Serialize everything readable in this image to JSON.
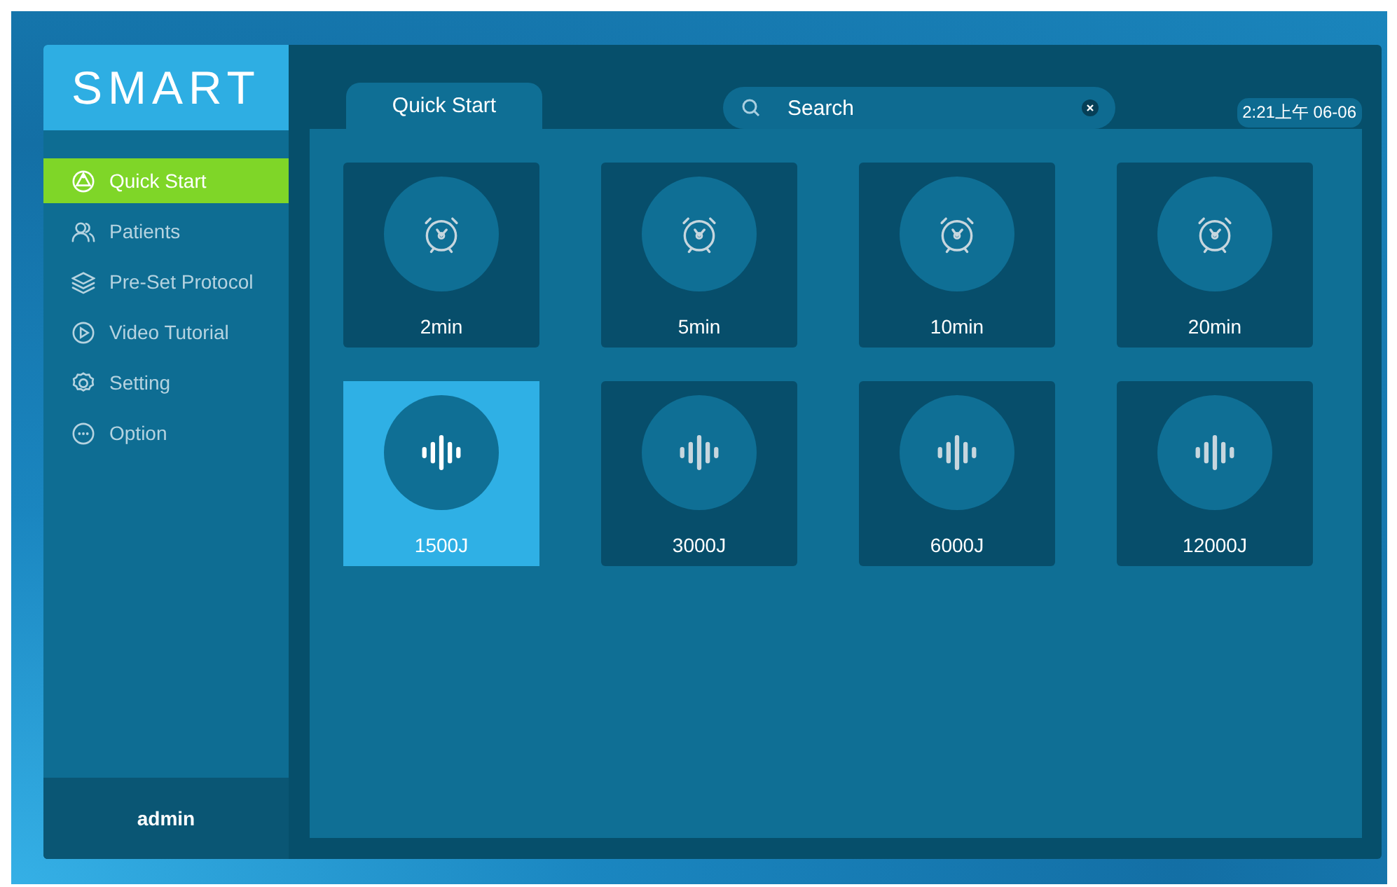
{
  "logo": "SMART",
  "sidebar": {
    "items": [
      {
        "label": "Quick Start",
        "selected": true
      },
      {
        "label": "Patients",
        "selected": false
      },
      {
        "label": "Pre-Set Protocol",
        "selected": false
      },
      {
        "label": "Video Tutorial",
        "selected": false
      },
      {
        "label": "Setting",
        "selected": false
      },
      {
        "label": "Option",
        "selected": false
      }
    ],
    "user": "admin"
  },
  "tabs": [
    {
      "label": "Quick Start",
      "selected": true
    }
  ],
  "search": {
    "placeholder": "Search"
  },
  "clock": "2:21上午 06-06",
  "tiles": [
    {
      "label": "2min",
      "kind": "timer",
      "selected": false
    },
    {
      "label": "5min",
      "kind": "timer",
      "selected": false
    },
    {
      "label": "10min",
      "kind": "timer",
      "selected": false
    },
    {
      "label": "20min",
      "kind": "timer",
      "selected": false
    },
    {
      "label": "1500J",
      "kind": "energy",
      "selected": true
    },
    {
      "label": "3000J",
      "kind": "energy",
      "selected": false
    },
    {
      "label": "6000J",
      "kind": "energy",
      "selected": false
    },
    {
      "label": "12000J",
      "kind": "energy",
      "selected": false
    }
  ]
}
